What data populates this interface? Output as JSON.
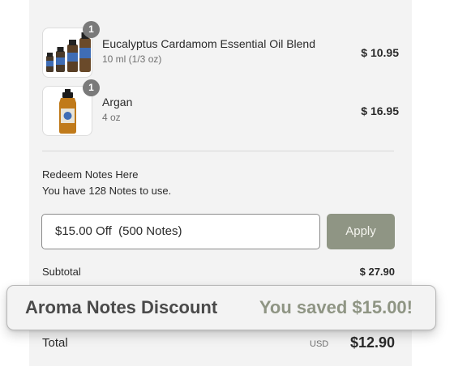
{
  "items": [
    {
      "name": "Eucalyptus Cardamom Essential Oil Blend",
      "variant": "10 ml (1/3 oz)",
      "price": "$ 10.95",
      "quantity": "1",
      "image_icon": "essential-oil-bottles-icon"
    },
    {
      "name": "Argan",
      "variant": "4 oz",
      "price": "$ 16.95",
      "quantity": "1",
      "image_icon": "argan-oil-bottle-icon"
    }
  ],
  "rewards": {
    "title": "Redeem Notes Here",
    "subtitle": "You have 128 Notes to use.",
    "selected_option": "$15.00 Off  (500 Notes)",
    "apply_label": "Apply"
  },
  "summary": {
    "subtotal_label": "Subtotal",
    "subtotal_value": "$ 27.90",
    "total_label": "Total",
    "currency": "USD",
    "total_value": "$12.90"
  },
  "discount_banner": {
    "label": "Aroma Notes Discount",
    "saved": "You saved $15.00!"
  },
  "colors": {
    "accent": "#8f9584",
    "panel_background": "#f3f3f3",
    "badge": "#7a7a7a"
  }
}
